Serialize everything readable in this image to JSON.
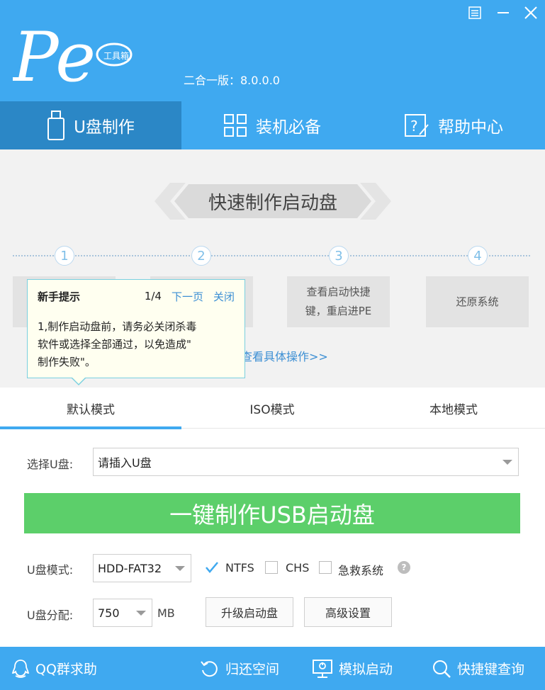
{
  "header": {
    "version_text": "二合一版：8.0.0.0",
    "logo_text": "Pe",
    "logo_badge": "工具箱"
  },
  "window_controls": {
    "menu_icon": "menu-icon",
    "minimize_icon": "minimize-icon",
    "close_icon": "close-icon"
  },
  "nav": {
    "tabs": [
      {
        "label": "U盘制作",
        "icon": "usb-icon"
      },
      {
        "label": "装机必备",
        "icon": "grid-icon"
      },
      {
        "label": "帮助中心",
        "icon": "help-icon"
      }
    ]
  },
  "steps": {
    "banner": "快速制作启动盘",
    "numbers": [
      "1",
      "2",
      "3",
      "4"
    ],
    "boxes": [
      {
        "text": ""
      },
      {
        "text": ""
      },
      {
        "text": "查看启动快捷键，重启进PE"
      },
      {
        "text": "还原系统"
      }
    ],
    "box3_line1": "查看启动快捷",
    "box3_line2": "键，重启进PE",
    "detail_link": "查看具体操作>>"
  },
  "tooltip": {
    "title": "新手提示",
    "page": "1/4",
    "next": "下一页",
    "close": "关闭",
    "body_line1": "1,制作启动盘前，请务必关闭杀毒",
    "body_line2": "软件或选择全部通过，以免造成\"",
    "body_line3": "制作失败\"。"
  },
  "modes": {
    "tabs": [
      "默认模式",
      "ISO模式",
      "本地模式"
    ]
  },
  "form": {
    "select_label": "选择U盘:",
    "select_value": "请插入U盘",
    "make_button": "一键制作USB启动盘",
    "mode_label": "U盘模式:",
    "mode_value": "HDD-FAT32",
    "ntfs_label": "NTFS",
    "ntfs_checked": true,
    "chs_label": "CHS",
    "chs_checked": false,
    "rescue_label": "急救系统",
    "rescue_checked": false,
    "help_glyph": "?",
    "partition_label": "U盘分配:",
    "partition_value": "750",
    "partition_unit": "MB",
    "upgrade_button": "升级启动盘",
    "advanced_button": "高级设置"
  },
  "footer": {
    "items": [
      {
        "label": "QQ群求助",
        "icon": "qq-icon"
      },
      {
        "label": "归还空间",
        "icon": "restore-icon"
      },
      {
        "label": "模拟启动",
        "icon": "monitor-icon"
      },
      {
        "label": "快捷键查询",
        "icon": "search-icon"
      }
    ]
  },
  "colors": {
    "brand": "#3fa9f0",
    "brand_dark": "#2b87c6",
    "primary_button": "#5ccf6a",
    "link": "#3c8fd4"
  }
}
